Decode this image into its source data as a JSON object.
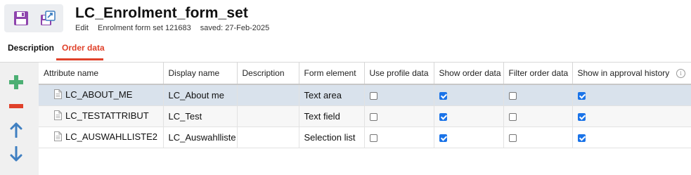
{
  "header": {
    "title": "LC_Enrolment_form_set",
    "mode": "Edit",
    "type_id": "Enrolment form set 121683",
    "saved": "saved: 27-Feb-2025"
  },
  "toolbar": {
    "save_icon": "save-icon",
    "save_as_icon": "save-as-icon",
    "accent": "#8e44ad"
  },
  "tabs": [
    {
      "label": "Description"
    },
    {
      "label": "Order data",
      "active": true
    }
  ],
  "colors": {
    "tab_active": "#e0412a",
    "add": "#4caf73",
    "remove": "#e0412a",
    "move": "#3f7fc1",
    "checkbox_on": "#1a73e8",
    "selected_row": "#d9e2ec"
  },
  "leftbar": [
    {
      "icon": "plus-icon"
    },
    {
      "icon": "minus-icon"
    },
    {
      "icon": "arrow-up-icon"
    },
    {
      "icon": "arrow-down-icon"
    }
  ],
  "grid": {
    "columns": [
      "Attribute name",
      "Display name",
      "Description",
      "Form element",
      "Use profile data",
      "Show order data",
      "Filter order data",
      "Show in approval history"
    ],
    "info_icon": "i",
    "rows": [
      {
        "attribute": "LC_ABOUT_ME",
        "display": "LC_About me",
        "description": "",
        "element": "Text area",
        "use_profile": false,
        "show_order": true,
        "filter_order": false,
        "approval": true
      },
      {
        "attribute": "LC_TESTATTRIBUT",
        "display": "LC_Test",
        "description": "",
        "element": "Text field",
        "use_profile": false,
        "show_order": true,
        "filter_order": false,
        "approval": true
      },
      {
        "attribute": "LC_AUSWAHLLISTE2",
        "display": "LC_Auswahlliste",
        "description": "",
        "element": "Selection list",
        "use_profile": false,
        "show_order": true,
        "filter_order": false,
        "approval": true
      }
    ]
  }
}
